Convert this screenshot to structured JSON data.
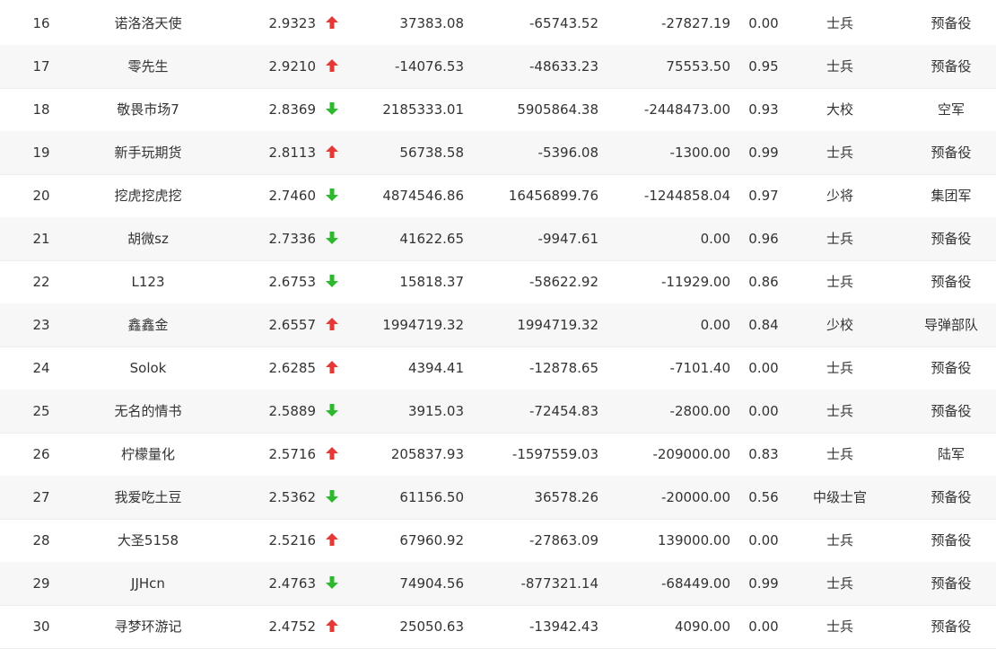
{
  "colors": {
    "up": "#e53935",
    "down": "#2eb82e",
    "row_stripe": "#f7f7f7",
    "text": "#333333"
  },
  "rows": [
    {
      "rank": "16",
      "name": "诺洛洛天使",
      "score": "2.9323",
      "trend": "up",
      "v1": "37383.08",
      "v2": "-65743.52",
      "v3": "-27827.19",
      "ratio": "0.00",
      "level": "士兵",
      "unit": "预备役"
    },
    {
      "rank": "17",
      "name": "零先生",
      "score": "2.9210",
      "trend": "up",
      "v1": "-14076.53",
      "v2": "-48633.23",
      "v3": "75553.50",
      "ratio": "0.95",
      "level": "士兵",
      "unit": "预备役"
    },
    {
      "rank": "18",
      "name": "敬畏市场7",
      "score": "2.8369",
      "trend": "down",
      "v1": "2185333.01",
      "v2": "5905864.38",
      "v3": "-2448473.00",
      "ratio": "0.93",
      "level": "大校",
      "unit": "空军"
    },
    {
      "rank": "19",
      "name": "新手玩期货",
      "score": "2.8113",
      "trend": "up",
      "v1": "56738.58",
      "v2": "-5396.08",
      "v3": "-1300.00",
      "ratio": "0.99",
      "level": "士兵",
      "unit": "预备役"
    },
    {
      "rank": "20",
      "name": "挖虎挖虎挖",
      "score": "2.7460",
      "trend": "down",
      "v1": "4874546.86",
      "v2": "16456899.76",
      "v3": "-1244858.04",
      "ratio": "0.97",
      "level": "少将",
      "unit": "集团军"
    },
    {
      "rank": "21",
      "name": "胡微sz",
      "score": "2.7336",
      "trend": "down",
      "v1": "41622.65",
      "v2": "-9947.61",
      "v3": "0.00",
      "ratio": "0.96",
      "level": "士兵",
      "unit": "预备役"
    },
    {
      "rank": "22",
      "name": "L123",
      "score": "2.6753",
      "trend": "down",
      "v1": "15818.37",
      "v2": "-58622.92",
      "v3": "-11929.00",
      "ratio": "0.86",
      "level": "士兵",
      "unit": "预备役"
    },
    {
      "rank": "23",
      "name": "鑫鑫金",
      "score": "2.6557",
      "trend": "up",
      "v1": "1994719.32",
      "v2": "1994719.32",
      "v3": "0.00",
      "ratio": "0.84",
      "level": "少校",
      "unit": "导弹部队"
    },
    {
      "rank": "24",
      "name": "Solok",
      "score": "2.6285",
      "trend": "up",
      "v1": "4394.41",
      "v2": "-12878.65",
      "v3": "-7101.40",
      "ratio": "0.00",
      "level": "士兵",
      "unit": "预备役"
    },
    {
      "rank": "25",
      "name": "无名的情书",
      "score": "2.5889",
      "trend": "down",
      "v1": "3915.03",
      "v2": "-72454.83",
      "v3": "-2800.00",
      "ratio": "0.00",
      "level": "士兵",
      "unit": "预备役"
    },
    {
      "rank": "26",
      "name": "柠檬量化",
      "score": "2.5716",
      "trend": "up",
      "v1": "205837.93",
      "v2": "-1597559.03",
      "v3": "-209000.00",
      "ratio": "0.83",
      "level": "士兵",
      "unit": "陆军"
    },
    {
      "rank": "27",
      "name": "我爱吃土豆",
      "score": "2.5362",
      "trend": "down",
      "v1": "61156.50",
      "v2": "36578.26",
      "v3": "-20000.00",
      "ratio": "0.56",
      "level": "中级士官",
      "unit": "预备役"
    },
    {
      "rank": "28",
      "name": "大圣5158",
      "score": "2.5216",
      "trend": "up",
      "v1": "67960.92",
      "v2": "-27863.09",
      "v3": "139000.00",
      "ratio": "0.00",
      "level": "士兵",
      "unit": "预备役"
    },
    {
      "rank": "29",
      "name": "JJHcn",
      "score": "2.4763",
      "trend": "down",
      "v1": "74904.56",
      "v2": "-877321.14",
      "v3": "-68449.00",
      "ratio": "0.99",
      "level": "士兵",
      "unit": "预备役"
    },
    {
      "rank": "30",
      "name": "寻梦环游记",
      "score": "2.4752",
      "trend": "up",
      "v1": "25050.63",
      "v2": "-13942.43",
      "v3": "4090.00",
      "ratio": "0.00",
      "level": "士兵",
      "unit": "预备役"
    }
  ]
}
